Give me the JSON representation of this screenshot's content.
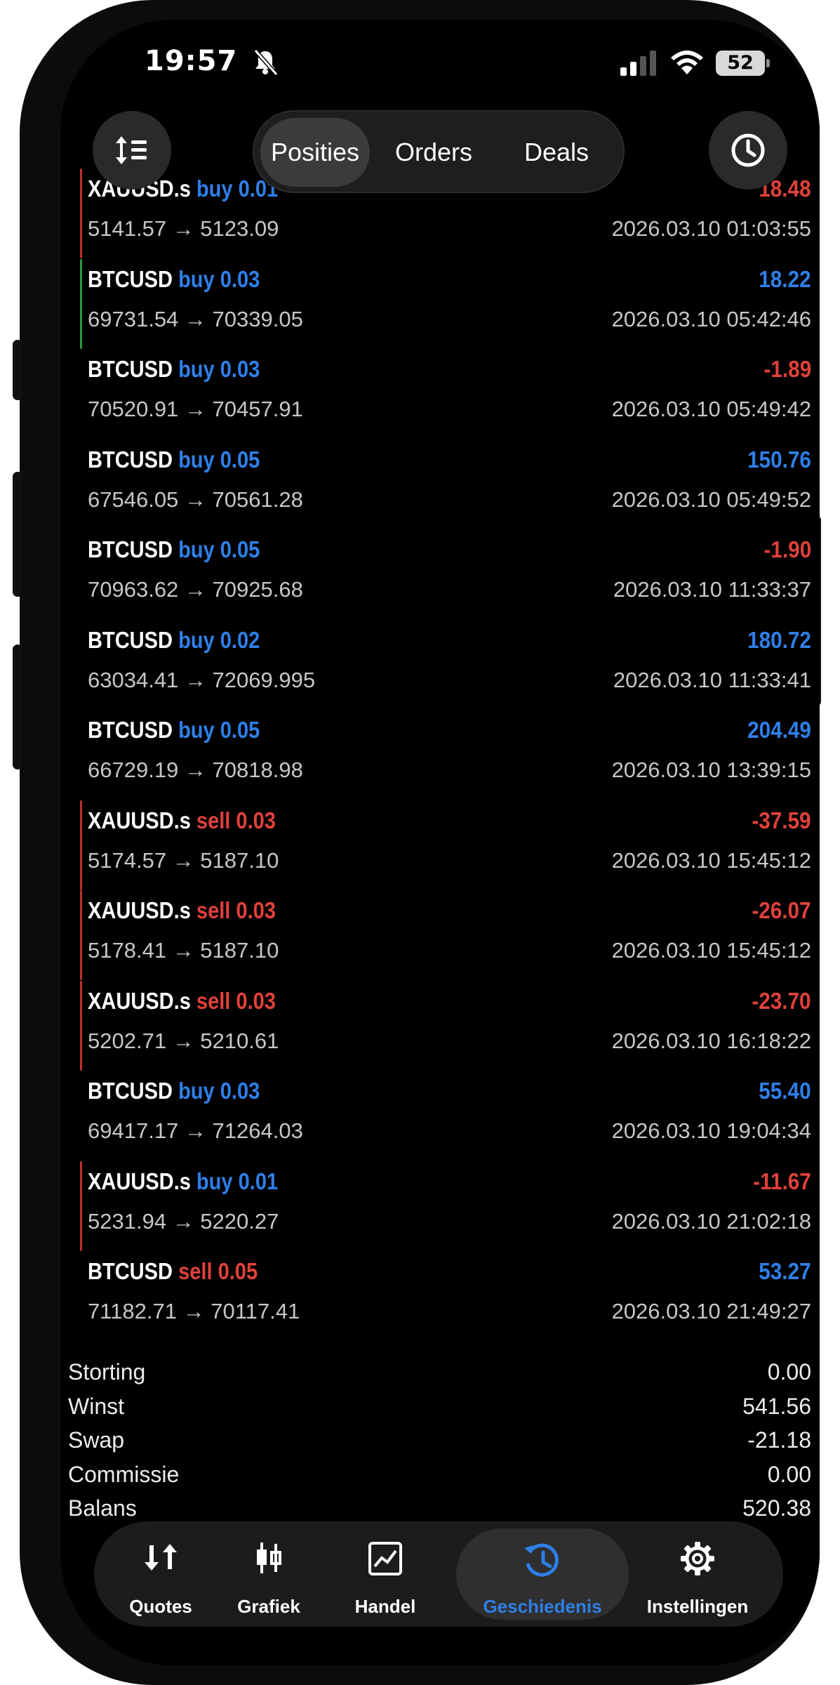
{
  "status_bar": {
    "time": "19:57",
    "battery": "52"
  },
  "top_bar": {
    "tabs": [
      {
        "label": "Posities",
        "active": true
      },
      {
        "label": "Orders",
        "active": false
      },
      {
        "label": "Deals",
        "active": false
      }
    ]
  },
  "deals": [
    {
      "symbol": "XAUUSD.s",
      "direction": "buy",
      "volume": "0.01",
      "profit": "18.48",
      "price": "5141.57 → 5123.09",
      "time": "2026.03.10 01:03:55",
      "bar": "#c0302c",
      "dir_color": "blue",
      "profit_color": "red"
    },
    {
      "symbol": "BTCUSD",
      "direction": "buy",
      "volume": "0.03",
      "profit": "18.22",
      "price": "69731.54 → 70339.05",
      "time": "2026.03.10 05:42:46",
      "bar": "#2e9a3e",
      "dir_color": "blue",
      "profit_color": "blue"
    },
    {
      "symbol": "BTCUSD",
      "direction": "buy",
      "volume": "0.03",
      "profit": "-1.89",
      "price": "70520.91 → 70457.91",
      "time": "2026.03.10 05:49:42",
      "bar": "",
      "dir_color": "blue",
      "profit_color": "red"
    },
    {
      "symbol": "BTCUSD",
      "direction": "buy",
      "volume": "0.05",
      "profit": "150.76",
      "price": "67546.05 → 70561.28",
      "time": "2026.03.10 05:49:52",
      "bar": "",
      "dir_color": "blue",
      "profit_color": "blue"
    },
    {
      "symbol": "BTCUSD",
      "direction": "buy",
      "volume": "0.05",
      "profit": "-1.90",
      "price": "70963.62 → 70925.68",
      "time": "2026.03.10 11:33:37",
      "bar": "",
      "dir_color": "blue",
      "profit_color": "red"
    },
    {
      "symbol": "BTCUSD",
      "direction": "buy",
      "volume": "0.02",
      "profit": "180.72",
      "price": "63034.41 → 72069.995",
      "time": "2026.03.10 11:33:41",
      "bar": "",
      "dir_color": "blue",
      "profit_color": "blue"
    },
    {
      "symbol": "BTCUSD",
      "direction": "buy",
      "volume": "0.05",
      "profit": "204.49",
      "price": "66729.19 → 70818.98",
      "time": "2026.03.10 13:39:15",
      "bar": "",
      "dir_color": "blue",
      "profit_color": "blue"
    },
    {
      "symbol": "XAUUSD.s",
      "direction": "sell",
      "volume": "0.03",
      "profit": "-37.59",
      "price": "5174.57 → 5187.10",
      "time": "2026.03.10 15:45:12",
      "bar": "#c0302c",
      "dir_color": "red",
      "profit_color": "red"
    },
    {
      "symbol": "XAUUSD.s",
      "direction": "sell",
      "volume": "0.03",
      "profit": "-26.07",
      "price": "5178.41 → 5187.10",
      "time": "2026.03.10 15:45:12",
      "bar": "#c0302c",
      "dir_color": "red",
      "profit_color": "red"
    },
    {
      "symbol": "XAUUSD.s",
      "direction": "sell",
      "volume": "0.03",
      "profit": "-23.70",
      "price": "5202.71 → 5210.61",
      "time": "2026.03.10 16:18:22",
      "bar": "#c0302c",
      "dir_color": "red",
      "profit_color": "red"
    },
    {
      "symbol": "BTCUSD",
      "direction": "buy",
      "volume": "0.03",
      "profit": "55.40",
      "price": "69417.17 → 71264.03",
      "time": "2026.03.10 19:04:34",
      "bar": "",
      "dir_color": "blue",
      "profit_color": "blue"
    },
    {
      "symbol": "XAUUSD.s",
      "direction": "buy",
      "volume": "0.01",
      "profit": "-11.67",
      "price": "5231.94 → 5220.27",
      "time": "2026.03.10 21:02:18",
      "bar": "#c0302c",
      "dir_color": "blue",
      "profit_color": "red"
    },
    {
      "symbol": "BTCUSD",
      "direction": "sell",
      "volume": "0.05",
      "profit": "53.27",
      "price": "71182.71 → 70117.41",
      "time": "2026.03.10 21:49:27",
      "bar": "",
      "dir_color": "red",
      "profit_color": "blue"
    }
  ],
  "summary": [
    {
      "label": "Storting",
      "value": "0.00"
    },
    {
      "label": "Winst",
      "value": "541.56"
    },
    {
      "label": "Swap",
      "value": "-21.18"
    },
    {
      "label": "Commissie",
      "value": "0.00"
    },
    {
      "label": "Balans",
      "value": "520.38"
    }
  ],
  "tabbar": {
    "quotes": "Quotes",
    "chart": "Grafiek",
    "trade": "Handel",
    "history": "Geschiedenis",
    "settings": "Instellingen",
    "active": "history",
    "accent": "#2f7fe8"
  },
  "colors": {
    "blue": "#2f7fe8",
    "red": "#e0413b",
    "green_bar": "#2e9a3e",
    "red_bar": "#c0302c"
  },
  "icons": {
    "sort": "sort-icon",
    "history": "clock-icon"
  }
}
